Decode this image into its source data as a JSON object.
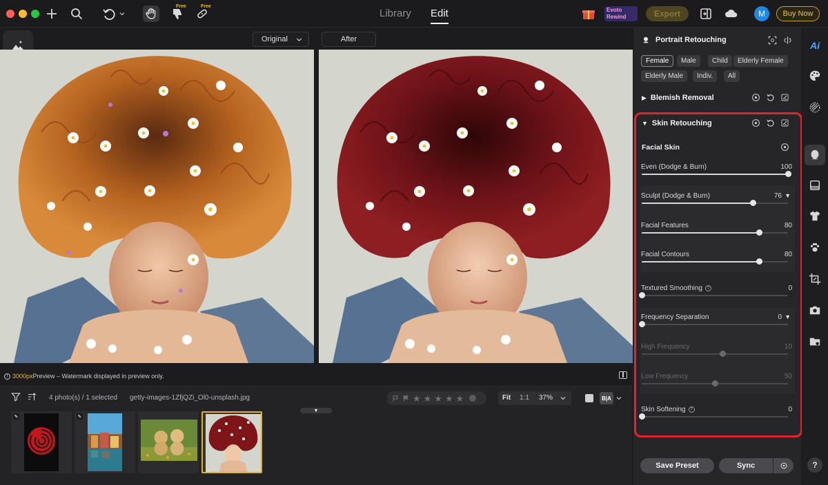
{
  "topbar": {
    "tabs": [
      {
        "label": "Library"
      },
      {
        "label": "Edit"
      }
    ],
    "free_label": "Free",
    "export_label": "Export",
    "buy_label": "Buy Now",
    "avatar_initial": "M",
    "promo_text": "Evoto Rewind"
  },
  "view": {
    "original_label": "Original",
    "after_label": "After"
  },
  "preview_notice": {
    "size": "3000px",
    "text": " Preview – Watermark displayed in preview only."
  },
  "filmstrip": {
    "count_text": "4 photo(s) / 1 selected",
    "filename": "getty-images-1ZfjQZi_Ol0-unsplash.jpg",
    "zoom_fit": "Fit",
    "zoom_1to1": "1:1",
    "zoom_level": "37%",
    "compare_label": "B|A",
    "thumbnails": [
      {
        "name": "red-spiral",
        "edited": true,
        "selected": false
      },
      {
        "name": "city-canal",
        "edited": true,
        "selected": false
      },
      {
        "name": "puppies",
        "edited": false,
        "selected": false
      },
      {
        "name": "flower-hair-portrait",
        "edited": true,
        "selected": true
      }
    ]
  },
  "panel": {
    "title": "Portrait Retouching",
    "chips": [
      "Female",
      "Male",
      "Child",
      "Elderly Female",
      "Elderly Male",
      "Indiv.",
      "All"
    ],
    "active_chip": "Female",
    "blemish_label": "Blemish Removal",
    "skin_label": "Skin Retouching",
    "facial_skin_label": "Facial Skin",
    "sliders": [
      {
        "label": "Even (Dodge & Burn)",
        "value": "100",
        "fraction": 1.0
      },
      {
        "label": "Sculpt (Dodge & Burn)",
        "value": "76",
        "fraction": 0.76
      },
      {
        "label": "Facial Features",
        "value": "80",
        "fraction": 0.8
      },
      {
        "label": "Facial Contours",
        "value": "80",
        "fraction": 0.8
      },
      {
        "label": "Textured Smoothing",
        "value": "0",
        "fraction": 0.0
      },
      {
        "label": "Frequency Separation",
        "value": "0",
        "fraction": 0.0
      },
      {
        "label": "High Frequency",
        "value": "10",
        "fraction": 0.55
      },
      {
        "label": "Low Frequency",
        "value": "50",
        "fraction": 0.5
      },
      {
        "label": "Skin Softening",
        "value": "0",
        "fraction": 0.0
      }
    ],
    "save_preset_label": "Save Preset",
    "sync_label": "Sync"
  },
  "rail": {
    "ai_label": "Ai",
    "help_label": "?"
  },
  "colors": {
    "accent_gold": "#d8b23a",
    "highlight_red": "#e6232a",
    "avatar_blue": "#1e88e5"
  }
}
